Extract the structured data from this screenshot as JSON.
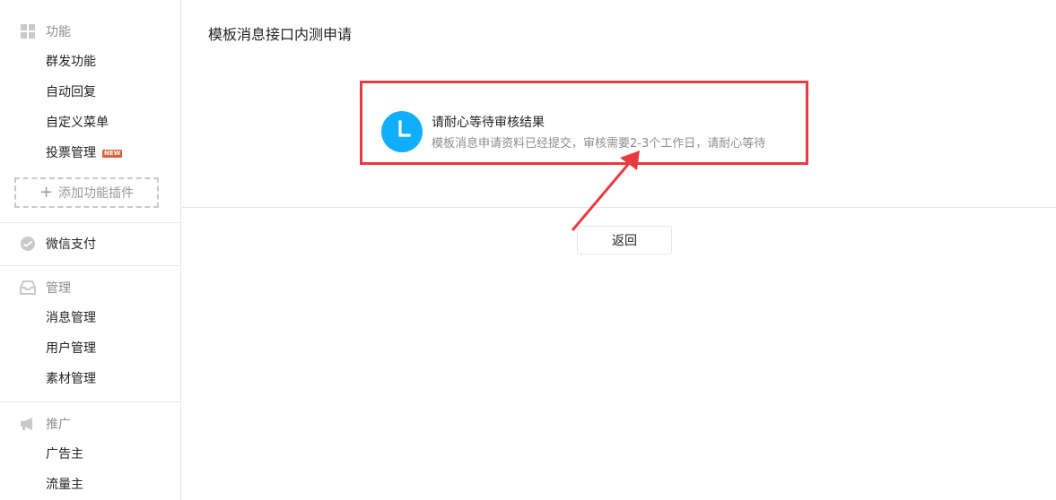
{
  "sidebar": {
    "sections": [
      {
        "title": "功能",
        "icon": "grid-icon",
        "items": [
          {
            "label": "群发功能"
          },
          {
            "label": "自动回复"
          },
          {
            "label": "自定义菜单"
          },
          {
            "label": "投票管理",
            "badge": "NEW"
          }
        ],
        "add_plugin_label": "添加功能插件"
      },
      {
        "title": "微信支付",
        "icon": "wechat-pay-icon",
        "items": []
      },
      {
        "title": "管理",
        "icon": "inbox-icon",
        "items": [
          {
            "label": "消息管理"
          },
          {
            "label": "用户管理"
          },
          {
            "label": "素材管理"
          }
        ]
      },
      {
        "title": "推广",
        "icon": "megaphone-icon",
        "items": [
          {
            "label": "广告主"
          },
          {
            "label": "流量主"
          }
        ]
      }
    ]
  },
  "main": {
    "page_title": "模板消息接口内测申请",
    "notice": {
      "icon": "clock-icon",
      "title": "请耐心等待审核结果",
      "description": "模板消息申请资料已经提交，审核需要2-3个工作日，请耐心等待"
    },
    "back_button_label": "返回"
  },
  "colors": {
    "highlight_border": "#e63b40",
    "clock_blue": "#10aeff",
    "badge_red": "#e15f3b",
    "muted_text": "#8d8d8d",
    "divider": "#e7e7eb"
  }
}
